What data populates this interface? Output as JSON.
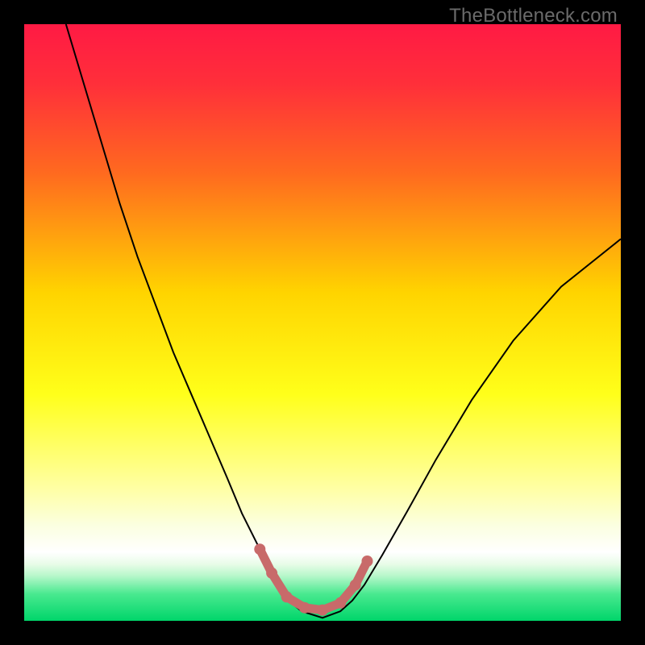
{
  "watermark": "TheBottleneck.com",
  "chart_data": {
    "type": "line",
    "title": "",
    "xlabel": "",
    "ylabel": "",
    "xlim": [
      0,
      100
    ],
    "ylim": [
      0,
      100
    ],
    "gradient_stops": [
      {
        "offset": 0.0,
        "color": "#ff1a44"
      },
      {
        "offset": 0.1,
        "color": "#ff2f3a"
      },
      {
        "offset": 0.25,
        "color": "#ff6a1f"
      },
      {
        "offset": 0.45,
        "color": "#ffd400"
      },
      {
        "offset": 0.62,
        "color": "#ffff1a"
      },
      {
        "offset": 0.78,
        "color": "#ffffa6"
      },
      {
        "offset": 0.84,
        "color": "#fbffe0"
      },
      {
        "offset": 0.885,
        "color": "#ffffff"
      },
      {
        "offset": 0.905,
        "color": "#e8fce8"
      },
      {
        "offset": 0.925,
        "color": "#b6f7ca"
      },
      {
        "offset": 0.955,
        "color": "#49e98f"
      },
      {
        "offset": 1.0,
        "color": "#00d56a"
      }
    ],
    "series": [
      {
        "name": "curve",
        "stroke": "#000000",
        "stroke_width": 2,
        "x": [
          7,
          10,
          13,
          16,
          19,
          22,
          25,
          28,
          31,
          34,
          36.5,
          39,
          41,
          43,
          44.5,
          46.5,
          50,
          53,
          55,
          57,
          60,
          64,
          69,
          75,
          82,
          90,
          100
        ],
        "y": [
          100,
          90,
          80,
          70,
          61,
          53,
          45,
          38,
          31,
          24,
          18,
          13,
          9,
          5.5,
          3.2,
          1.6,
          0.5,
          1.6,
          3.4,
          6,
          11,
          18,
          27,
          37,
          47,
          56,
          64
        ]
      }
    ],
    "highlight": {
      "stroke": "#c86a6a",
      "stroke_width": 11,
      "dot_radius": 7,
      "x": [
        39.5,
        41.5,
        44,
        47,
        50,
        53,
        55.5,
        57.5
      ],
      "y": [
        12,
        8,
        4,
        2.2,
        1.8,
        3,
        6,
        10
      ]
    }
  }
}
